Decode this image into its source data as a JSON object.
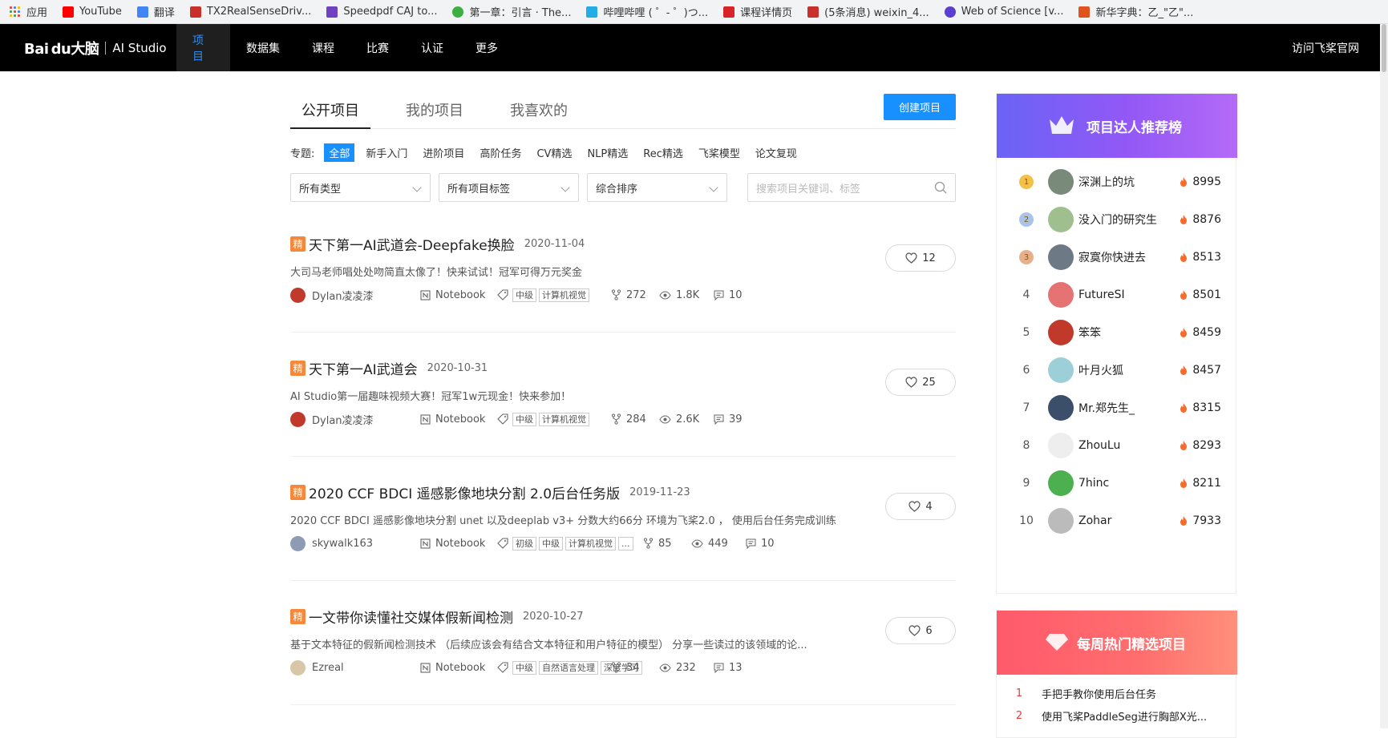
{
  "bookmarks": [
    {
      "label": "应用",
      "color": "#4285f4",
      "icon": "apps-grid-icon"
    },
    {
      "label": "YouTube",
      "color": "#ff0000",
      "icon": "youtube-icon"
    },
    {
      "label": "翻译",
      "color": "#4285f4",
      "icon": "translate-icon"
    },
    {
      "label": "TX2RealSenseDriv...",
      "color": "#c9302c",
      "icon": "csdn-icon"
    },
    {
      "label": "Speedpdf CAJ to...",
      "color": "#6f42c1",
      "icon": "speedpdf-icon"
    },
    {
      "label": "第一章：引言 · The...",
      "color": "#3cb043",
      "icon": "book-icon"
    },
    {
      "label": "哔哩哔哩 ( ゜- ゜)つ...",
      "color": "#23ade5",
      "icon": "bilibili-icon"
    },
    {
      "label": "课程详情页",
      "color": "#d8232a",
      "icon": "course-icon"
    },
    {
      "label": "(5条消息) weixin_4...",
      "color": "#c9302c",
      "icon": "csdn-icon"
    },
    {
      "label": "Web of Science [v...",
      "color": "#5b3fd1",
      "icon": "wos-icon"
    },
    {
      "label": "新华字典：乙_\"乙\"...",
      "color": "#e0531f",
      "icon": "dict-icon"
    }
  ],
  "topnav": {
    "logo_baidu": "Bai du大脑",
    "logo_studio": "AI Studio",
    "items": [
      "项目",
      "数据集",
      "课程",
      "比赛",
      "认证",
      "更多"
    ],
    "active_index": 0,
    "right_link": "访问飞桨官网"
  },
  "tabs": [
    "公开项目",
    "我的项目",
    "我喜欢的"
  ],
  "create_button": "创建项目",
  "topics": {
    "label": "专题:",
    "items": [
      "全部",
      "新手入门",
      "进阶项目",
      "高阶任务",
      "CV精选",
      "NLP精选",
      "Rec精选",
      "飞桨模型",
      "论文复现"
    ]
  },
  "filters": {
    "type": "所有类型",
    "tags": "所有项目标签",
    "sort": "综合排序",
    "search_placeholder": "搜索项目关键词、标签"
  },
  "badge": "精",
  "projects": [
    {
      "title": "天下第一AI武道会-Deepfake换脸",
      "date": "2020-11-04",
      "desc": "大司马老师唱处处吻简直太像了！快来试试！冠军可得万元奖金",
      "author": "Dylan凌凌漆",
      "type": "Notebook",
      "tags": [
        "中级",
        "计算机视觉"
      ],
      "forks": "272",
      "views": "1.8K",
      "comments": "10",
      "likes": "12",
      "avatar_color": "#c0392b"
    },
    {
      "title": "天下第一AI武道会",
      "date": "2020-10-31",
      "desc": "AI Studio第一届趣味视频大赛！冠军1w元现金！快来参加！",
      "author": "Dylan凌凌漆",
      "type": "Notebook",
      "tags": [
        "中级",
        "计算机视觉"
      ],
      "forks": "284",
      "views": "2.6K",
      "comments": "39",
      "likes": "25",
      "avatar_color": "#c0392b"
    },
    {
      "title": "2020 CCF BDCI 遥感影像地块分割 2.0后台任务版",
      "date": "2019-11-23",
      "desc": "2020 CCF BDCI 遥感影像地块分割 unet 以及deeplab v3+ 分数大约66分 环境为飞桨2.0 ， 使用后台任务完成训练",
      "author": "skywalk163",
      "type": "Notebook",
      "tags": [
        "初级",
        "中级",
        "计算机视觉",
        "..."
      ],
      "forks": "85",
      "views": "449",
      "comments": "10",
      "likes": "4",
      "avatar_color": "#8e9bb5"
    },
    {
      "title": "一文带你读懂社交媒体假新闻检测",
      "date": "2020-10-27",
      "desc": "基于文本特征的假新闻检测技术 （后续应该会有结合文本特征和用户特征的模型） 分享一些读过的该领域的论...",
      "author": "Ezreal",
      "type": "Notebook",
      "tags": [
        "中级",
        "自然语言处理",
        "深度学习"
      ],
      "forks": "34",
      "views": "232",
      "comments": "13",
      "likes": "6",
      "avatar_color": "#d9c6a8"
    }
  ],
  "ranking": {
    "title": "项目达人推荐榜",
    "items": [
      {
        "rank": "1",
        "name": "深渊上的坑",
        "score": "8995",
        "avatar_color": "#7a8a7a",
        "medal_color": "#f5c04a"
      },
      {
        "rank": "2",
        "name": "没入门的研究生",
        "score": "8876",
        "avatar_color": "#9fbf8f",
        "medal_color": "#a9c4e8"
      },
      {
        "rank": "3",
        "name": "寂寞你快进去",
        "score": "8513",
        "avatar_color": "#6d7a86",
        "medal_color": "#e8b08a"
      },
      {
        "rank": "4",
        "name": "FutureSI",
        "score": "8501",
        "avatar_color": "#e57373",
        "medal_color": ""
      },
      {
        "rank": "5",
        "name": "笨笨",
        "score": "8459",
        "avatar_color": "#c0392b",
        "medal_color": ""
      },
      {
        "rank": "6",
        "name": "叶月火狐",
        "score": "8457",
        "avatar_color": "#9ccfd8",
        "medal_color": ""
      },
      {
        "rank": "7",
        "name": "Mr.郑先生_",
        "score": "8315",
        "avatar_color": "#3b4f6b",
        "medal_color": ""
      },
      {
        "rank": "8",
        "name": "ZhouLu",
        "score": "8293",
        "avatar_color": "#eeeeee",
        "medal_color": ""
      },
      {
        "rank": "9",
        "name": "7hinc",
        "score": "8211",
        "avatar_color": "#4caf50",
        "medal_color": ""
      },
      {
        "rank": "10",
        "name": "Zohar",
        "score": "7933",
        "avatar_color": "#bbbbbb",
        "medal_color": ""
      }
    ]
  },
  "hot": {
    "title": "每周热门精选项目",
    "items": [
      {
        "rank": "1",
        "title": "手把手教你使用后台任务"
      },
      {
        "rank": "2",
        "title": "使用飞桨PaddleSeg进行胸部X光..."
      }
    ]
  }
}
